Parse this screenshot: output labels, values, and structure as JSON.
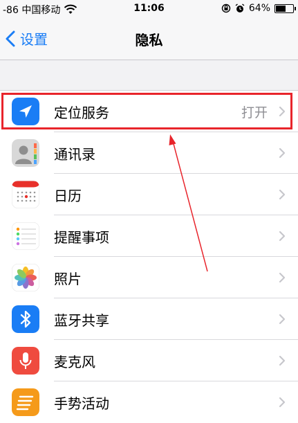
{
  "status_bar": {
    "carrier": "-86 中国移动",
    "time": "11:06",
    "battery": "64%",
    "battery_level": 0.64
  },
  "nav": {
    "back_label": "设置",
    "title": "隐私"
  },
  "rows": [
    {
      "label": "定位服务",
      "value": "打开",
      "icon": "location-arrow-icon"
    },
    {
      "label": "通讯录",
      "icon": "contacts-icon"
    },
    {
      "label": "日历",
      "icon": "calendar-icon"
    },
    {
      "label": "提醒事项",
      "icon": "reminders-icon"
    },
    {
      "label": "照片",
      "icon": "photos-icon"
    },
    {
      "label": "蓝牙共享",
      "icon": "bluetooth-icon"
    },
    {
      "label": "麦克风",
      "icon": "microphone-icon"
    },
    {
      "label": "手势活动",
      "icon": "motion-activity-icon"
    }
  ],
  "colors": {
    "accent": "#1a7df5",
    "highlight": "#e8242b",
    "location_icon": "#1a7df5",
    "bluetooth_icon": "#1a7df5",
    "microphone_icon": "#ef4b3f",
    "motion_icon": "#f59a1a"
  }
}
